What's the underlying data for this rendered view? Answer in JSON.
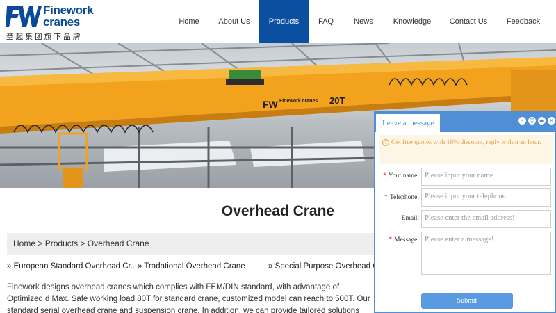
{
  "brand": {
    "logo_mark": "FW",
    "logo_line1": "Finework",
    "logo_line2": "cranes",
    "tagline_cn": "圣起集团旗下品牌",
    "color": "#0a4a98"
  },
  "nav": {
    "items": [
      {
        "label": "Home"
      },
      {
        "label": "About Us"
      },
      {
        "label": "Products",
        "active": true
      },
      {
        "label": "FAQ"
      },
      {
        "label": "News"
      },
      {
        "label": "Knowledge"
      },
      {
        "label": "Contact Us"
      },
      {
        "label": "Feedback"
      }
    ],
    "active_color": "#0a4fa0"
  },
  "banner": {
    "crane_logo": "Finework cranes",
    "crane_capacity": "20T",
    "crane_color": "#f2a21c"
  },
  "page": {
    "title": "Overhead Crane",
    "breadcrumb": [
      "Home",
      ">",
      "Products",
      ">",
      "Overhead Crane"
    ],
    "sublinks": [
      "» European Standard Overhead Cr...",
      "» Tradational Overhead Crane",
      "» Special Purpose Overhead C"
    ],
    "description": "Finework designs overhead cranes which complies with FEM/DIN standard, with advantage of Optimized d Max. Safe working load 80T for standard crane, customized model can reach to 500T. Our standard serial overhead crane and suspension crane. In addition, we can provide tailored solutions according to your spe"
  },
  "widget": {
    "tab_label": "Leave a message",
    "controls": [
      "minimize-icon",
      "chat-icon",
      "collapse-icon",
      "close-icon"
    ],
    "notice_icon": "i",
    "notice": "Get free quotes with 16% discount, reply within an hour.",
    "fields": [
      {
        "label": "Your name:",
        "required": true,
        "placeholder": "Please input your name"
      },
      {
        "label": "Telephone:",
        "required": true,
        "placeholder": "Please input your telephone."
      },
      {
        "label": "Email:",
        "required": false,
        "placeholder": "Please enter the email address!"
      },
      {
        "label": "Message:",
        "required": true,
        "placeholder": "Please enter a message!"
      }
    ],
    "submit_label": "Submit",
    "accent": "#4f8fd6"
  }
}
